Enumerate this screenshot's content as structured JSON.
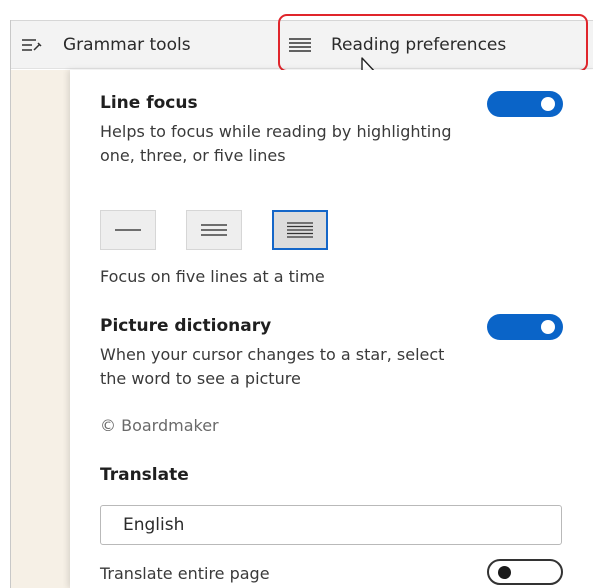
{
  "toolbar": {
    "grammar_tools_label": "Grammar tools",
    "reading_preferences_label": "Reading preferences"
  },
  "line_focus": {
    "title": "Line focus",
    "description": "Helps to focus while reading by highlighting one, three, or five lines",
    "enabled": true,
    "options": [
      "one line",
      "three lines",
      "five lines"
    ],
    "selected_option": "five lines",
    "status": "Focus on five lines at a time"
  },
  "picture_dictionary": {
    "title": "Picture dictionary",
    "description": "When your cursor changes to a star, select the word to see a picture",
    "credit": "© Boardmaker",
    "enabled": true
  },
  "translate": {
    "title": "Translate",
    "language_value": "English",
    "translate_page_label": "Translate entire page",
    "translate_page_enabled": false
  },
  "colors": {
    "toggle_on": "#0a64c8",
    "highlight_border": "#e0252b",
    "selected_border": "#1466c8"
  }
}
